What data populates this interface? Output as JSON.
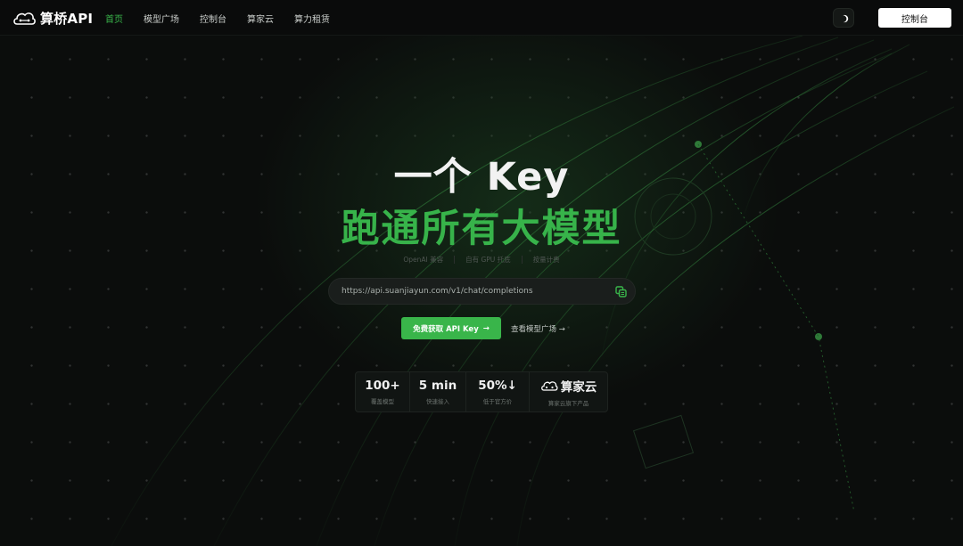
{
  "nav": {
    "logo_text": "算桥API",
    "links": [
      {
        "label": "首页",
        "active": true
      },
      {
        "label": "模型广场",
        "active": false
      },
      {
        "label": "控制台",
        "active": false
      },
      {
        "label": "算家云",
        "active": false
      },
      {
        "label": "算力租赁",
        "active": false
      }
    ],
    "theme_icon": "moon-icon",
    "console_button": "控制台"
  },
  "hero": {
    "title_line1": "一个 Key",
    "title_line2": "跑通所有大模型",
    "tags": [
      "OpenAI 兼容",
      "自有 GPU 托底",
      "按量计费"
    ],
    "endpoint_url": "https://api.suanjiayun.com/v1/chat/completions",
    "cta_label": "免费获取 API Key",
    "cta_arrow": "→",
    "secondary_link": "查看模型广场 →"
  },
  "stats": [
    {
      "value": "100+",
      "label": "覆盖模型"
    },
    {
      "value": "5 min",
      "label": "快速接入"
    },
    {
      "value": "50%↓",
      "label": "低于官方价"
    },
    {
      "value": "算家云",
      "label": "算家云旗下产品"
    }
  ],
  "colors": {
    "accent": "#39b54a",
    "background": "#0b0d0c"
  }
}
